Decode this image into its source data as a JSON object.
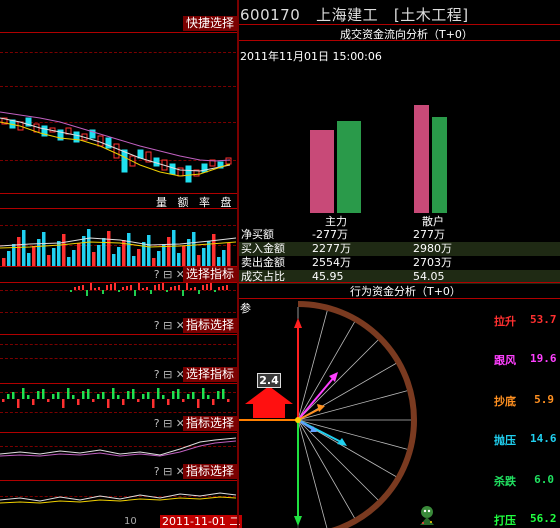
{
  "left": {
    "quick_select": "快捷选择",
    "volume_indicator_labels": [
      "量",
      "额",
      "率",
      "盘"
    ],
    "indicator_select_1": "选择指标",
    "indicator_select_2": "指标选择",
    "indicator_select_3": "选择指标",
    "indicator_select_4": "指标选择",
    "indicator_select_5": "指标选择",
    "toolbar_icons": "? ⊟ ✕",
    "bottom_time_count": "10",
    "bottom_date": "2011-11-01 二"
  },
  "right": {
    "stock_code": "600170",
    "stock_name": "上海建工",
    "industry": "[土木工程]",
    "cash_flow_title": "成交资金流向分析（T+0）",
    "datetime": "2011年11月01日 15:00:06",
    "columns": [
      "主力",
      "散户"
    ],
    "rows": [
      {
        "label": "净买额",
        "main": "-277万",
        "retail": "277万"
      },
      {
        "label": "买入金额",
        "main": "2277万",
        "retail": "2980万"
      },
      {
        "label": "卖出金额",
        "main": "2554万",
        "retail": "2703万"
      },
      {
        "label": "成交占比",
        "main": "45.95",
        "retail": "54.05"
      }
    ],
    "behavior_title": "行为资金分析（T+0）",
    "behavior_marker": "参",
    "arrow_value": "2.4",
    "forces": [
      {
        "label": "拉升",
        "value": "53.7",
        "color": "#ff3030"
      },
      {
        "label": "跟风",
        "value": "19.6",
        "color": "#ff40ff"
      },
      {
        "label": "抄底",
        "value": "5.9",
        "color": "#ff9020"
      },
      {
        "label": "抛压",
        "value": "14.6",
        "color": "#20d0f0"
      },
      {
        "label": "杀跌",
        "value": "6.0",
        "color": "#20e060"
      },
      {
        "label": "打压",
        "value": "56.2",
        "color": "#20ff40"
      }
    ]
  }
}
